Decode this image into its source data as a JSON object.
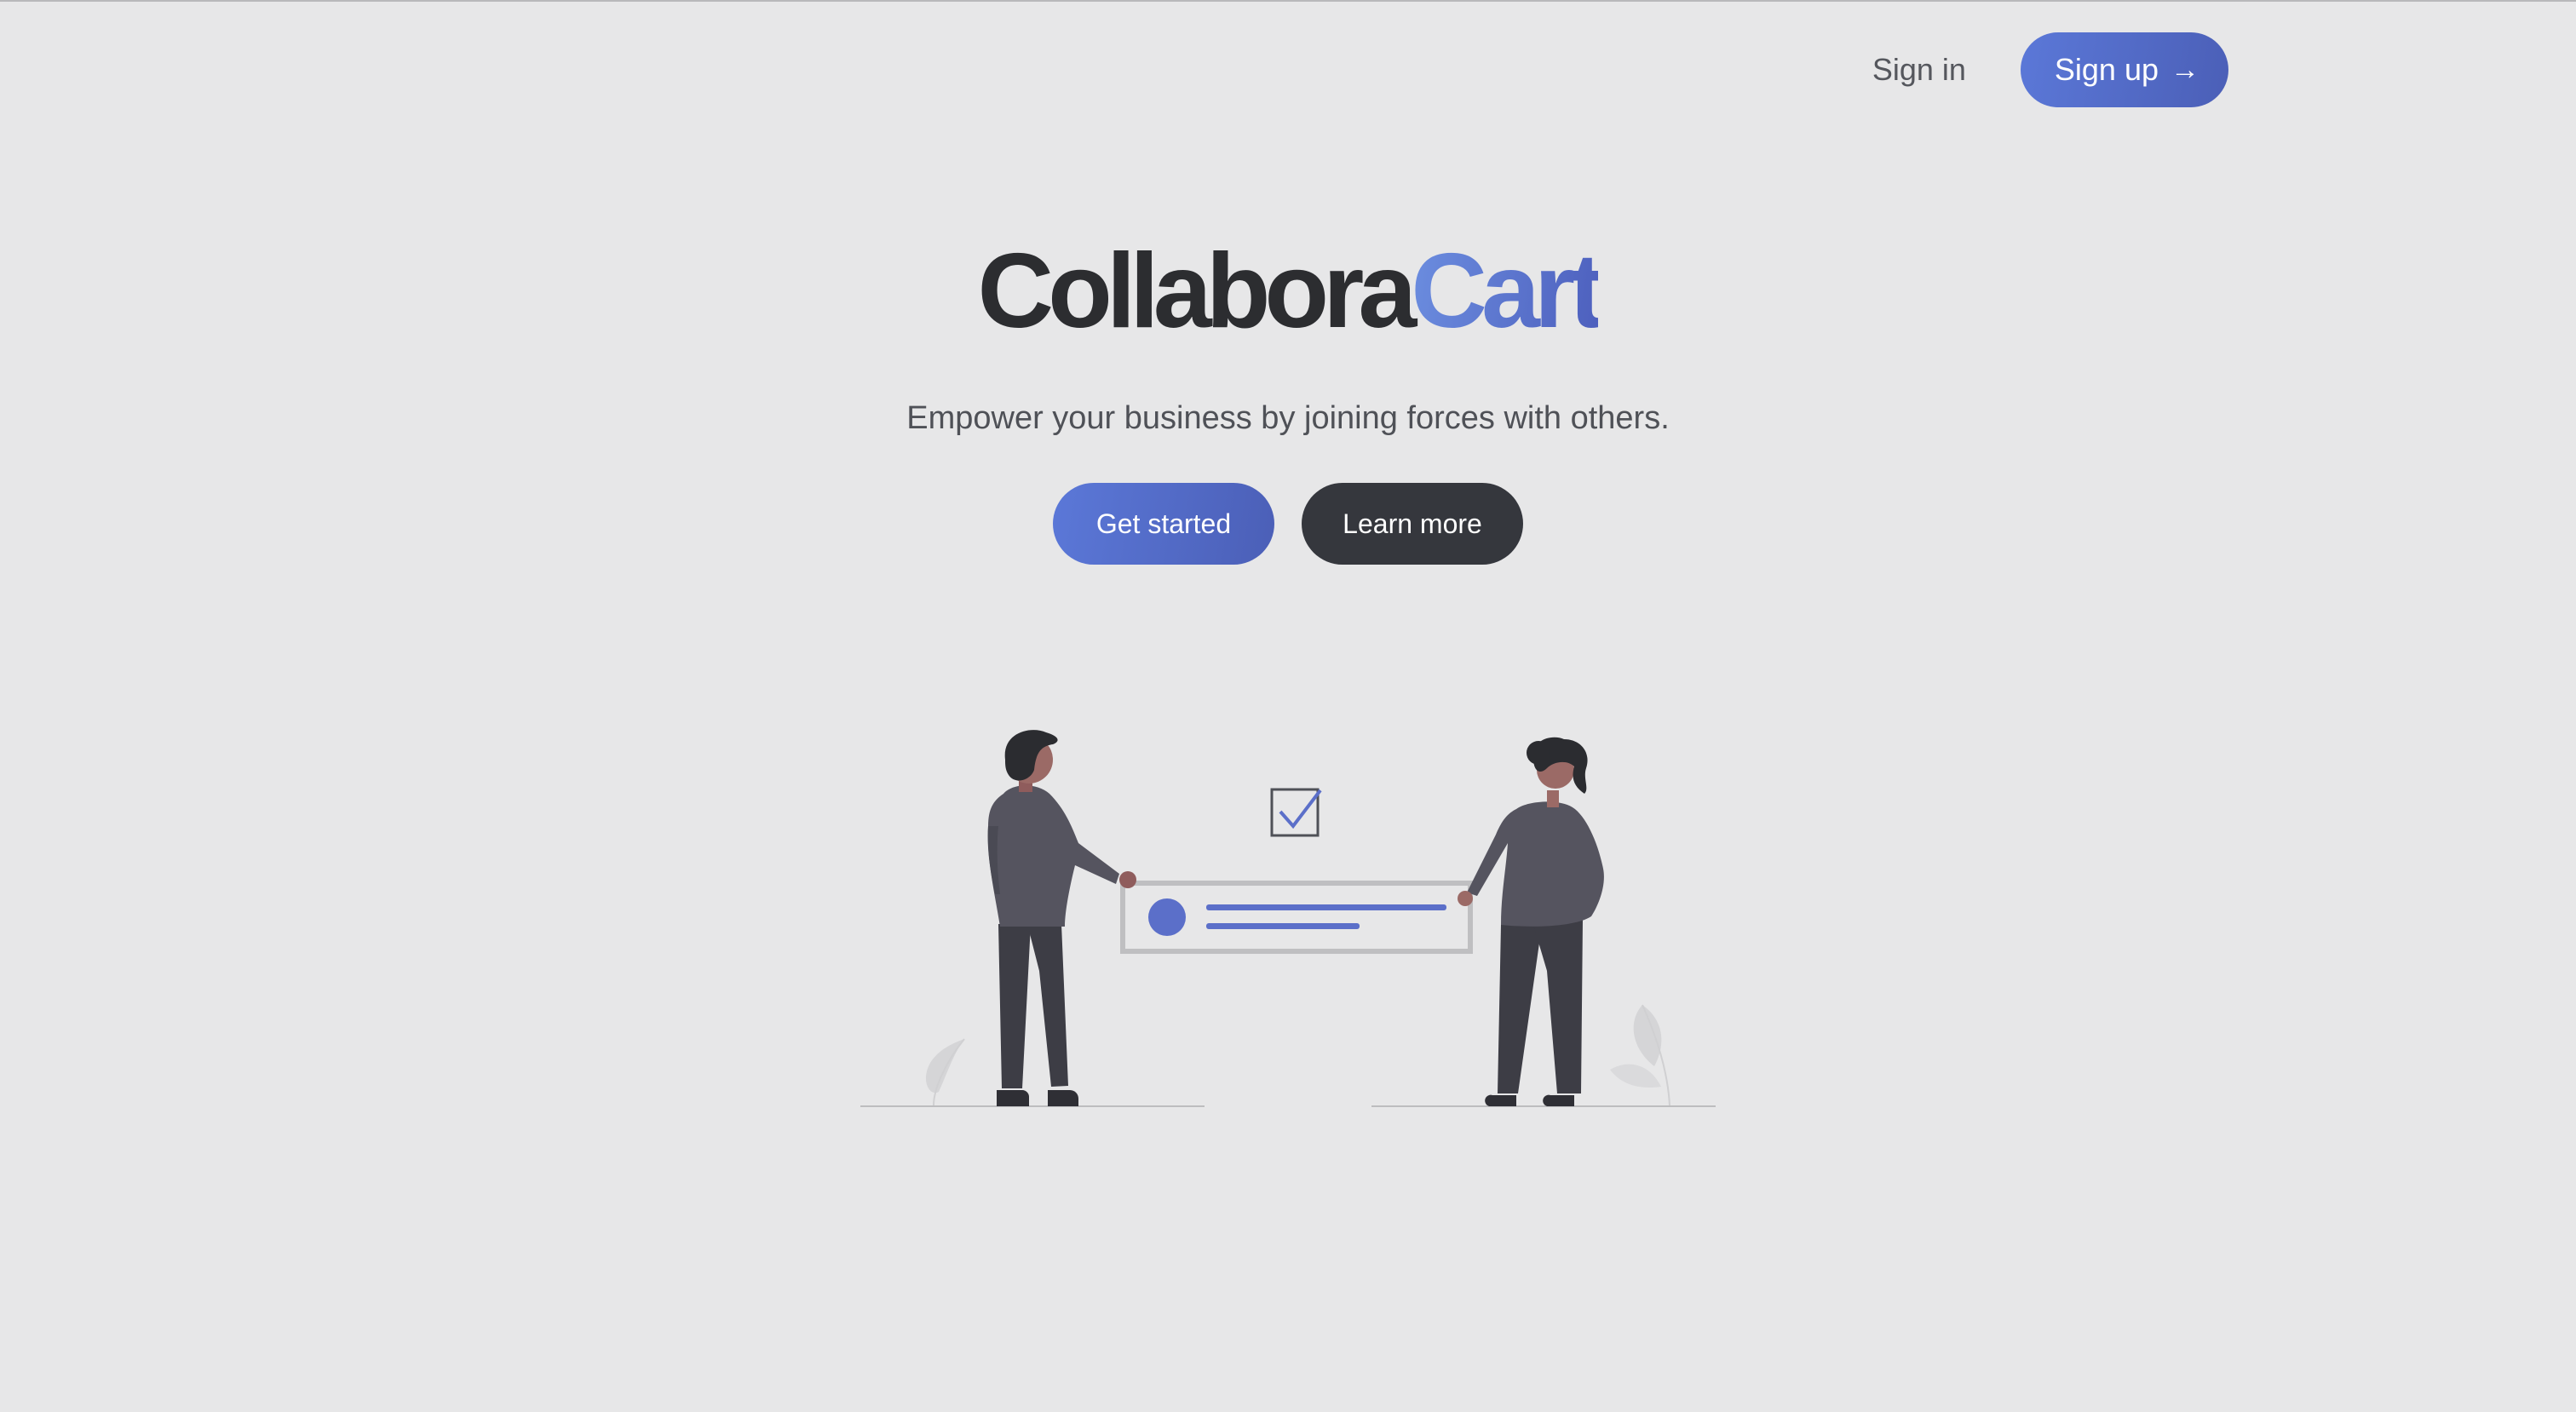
{
  "nav": {
    "sign_in": "Sign in",
    "sign_up": "Sign up",
    "sign_up_icon": "arrow-right-icon"
  },
  "hero": {
    "brand_part1": "Collabora",
    "brand_part2": "Cart",
    "tagline": "Empower your business by joining forces with others.",
    "primary_cta": "Get started",
    "secondary_cta": "Learn more"
  },
  "colors": {
    "background": "#e7e7e8",
    "accent": "#5b78d8",
    "accent_dark": "#4b5fb7",
    "dark_button": "#35373d",
    "text": "#2c2d30",
    "muted_text": "#4f5157"
  },
  "illustration": {
    "description_icons": [
      "person-man-icon",
      "person-woman-icon",
      "checkbox-checked-icon",
      "card-icon",
      "leaf-icon"
    ]
  }
}
